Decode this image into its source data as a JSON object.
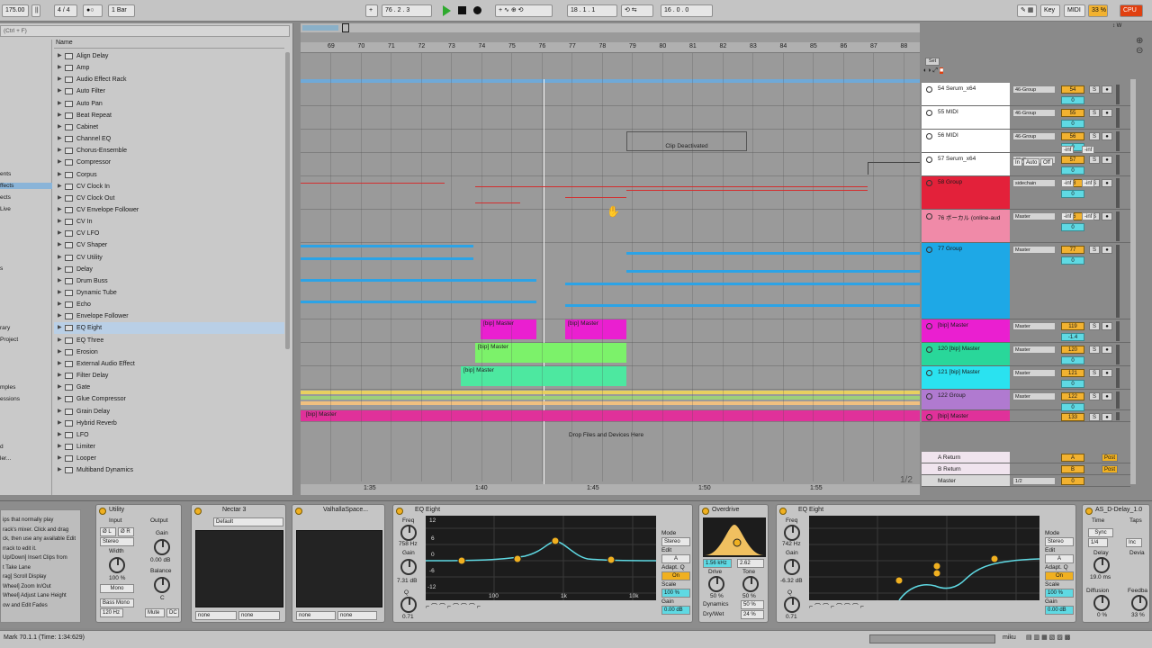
{
  "topbar": {
    "tempo": "175.00",
    "time_sig": "4 / 4",
    "quantize": "1 Bar",
    "position": "76 .  2 .  3",
    "loop_start": "18 .  1 .  1",
    "loop_len": "16 .  0 .  0",
    "key": "Key",
    "midi": "MIDI",
    "cpu_pct": "33 %",
    "cpu": "CPU"
  },
  "browser": {
    "search_placeholder": "(Ctrl + F)",
    "column_name": "Name",
    "places": [
      "ents",
      "ffects",
      "ects",
      "Live",
      "",
      "s",
      "rary",
      "Project",
      "",
      "mples",
      "essions",
      "",
      "d",
      "ler..."
    ],
    "items": [
      "Align Delay",
      "Amp",
      "Audio Effect Rack",
      "Auto Filter",
      "Auto Pan",
      "Beat Repeat",
      "Cabinet",
      "Channel EQ",
      "Chorus-Ensemble",
      "Compressor",
      "Corpus",
      "CV Clock In",
      "CV Clock Out",
      "CV Envelope Follower",
      "CV In",
      "CV LFO",
      "CV Shaper",
      "CV Utility",
      "Delay",
      "Drum Buss",
      "Dynamic Tube",
      "Echo",
      "Envelope Follower",
      "EQ Eight",
      "EQ Three",
      "Erosion",
      "External Audio Effect",
      "Filter Delay",
      "Gate",
      "Glue Compressor",
      "Grain Delay",
      "Hybrid Reverb",
      "LFO",
      "Limiter",
      "Looper",
      "Multiband Dynamics"
    ]
  },
  "ruler": {
    "bars": [
      "69",
      "70",
      "71",
      "72",
      "73",
      "74",
      "75",
      "76",
      "77",
      "78",
      "79",
      "80",
      "81",
      "82",
      "83",
      "84",
      "85",
      "86",
      "87",
      "88"
    ],
    "times": [
      "1:35",
      "1:40",
      "1:45",
      "1:50",
      "1:55"
    ]
  },
  "arrangement": {
    "clip_deactivated": "Clip Deactivated",
    "clip_bip_master": "[bip] Master",
    "drop_text": "Drop Files and Devices Here",
    "page_ratio": "1/2",
    "set_label": "Set"
  },
  "tracks": [
    {
      "name": "54 Serum_x64",
      "io": "46-Group",
      "num": "54",
      "vol": "0",
      "color": "#ffffff"
    },
    {
      "name": "55 MIDI",
      "io": "46-Group",
      "num": "55",
      "vol": "0",
      "color": "#ffffff"
    },
    {
      "name": "56 MIDI",
      "io": "46-Group",
      "num": "56",
      "vol": "0",
      "color": "#ffffff"
    },
    {
      "name": "57 Serum_x64",
      "io": "46-Group",
      "num": "57",
      "vol": "0",
      "color": "#ffffff"
    },
    {
      "name": "58 Group",
      "io": "sidechain",
      "num": "58",
      "vol": "0",
      "color": "#e3213a"
    },
    {
      "name": "76 ボーカル (online-aud",
      "io": "Master",
      "num": "76",
      "vol": "0",
      "color": "#f08aa8"
    },
    {
      "name": "77 Group",
      "io": "Master",
      "num": "77",
      "vol": "0",
      "color": "#1ea8e6"
    },
    {
      "name": "[bip] Master",
      "io": "Master",
      "num": "119",
      "vol": "-1.4",
      "color": "#ea1fd0"
    },
    {
      "name": "120 [bip] Master",
      "io": "Master",
      "num": "120",
      "vol": "0",
      "color": "#29d79a"
    },
    {
      "name": "121 [bip] Master",
      "io": "Master",
      "num": "121",
      "vol": "0",
      "color": "#2ae2f0"
    },
    {
      "name": "122 Group",
      "io": "Master",
      "num": "122",
      "vol": "0",
      "color": "#b07ad0"
    },
    {
      "name": "[bip] Master",
      "io": "",
      "num": "133",
      "vol": "0",
      "color": "#e0319a"
    }
  ],
  "returns": [
    {
      "name": "A Return",
      "num": "A",
      "post": "Post"
    },
    {
      "name": "B Return",
      "num": "B",
      "post": "Post"
    },
    {
      "name": "Master",
      "num": "0",
      "io": "1/2"
    }
  ],
  "meter_values": {
    "inf_a": "-inf",
    "inf_b": "-inf",
    "in": "In",
    "auto": "Auto",
    "off": "Off"
  },
  "info_text": [
    "ips that normally play",
    "rack's mixer. Click and drag",
    "ck, then use any available Edit",
    "rrack to edit it.",
    "",
    "Up/Down] Insert Clips from",
    "t Take Lane",
    "rag] Scroll Display",
    "Wheel] Zoom In/Out",
    "Wheel] Adjust Lane Height",
    "ow and Edit Fades"
  ],
  "devices": {
    "utility": {
      "title": "Utility",
      "input": "Input",
      "output": "Output",
      "stereo": "Stereo",
      "width": "Width",
      "width_val": "100 %",
      "mono": "Mono",
      "bass_mono": "Bass Mono",
      "bass_hz": "120 Hz",
      "gain": "Gain",
      "gain_val": "0.00 dB",
      "balance": "Balance",
      "balance_val": "C",
      "mute": "Mute",
      "dc": "DC",
      "l": "Ø L",
      "r": "Ø R"
    },
    "nectar": {
      "title": "Nectar 3",
      "preset": "Default",
      "none1": "none",
      "none2": "none"
    },
    "valhalla": {
      "title": "ValhallaSpace...",
      "none1": "none",
      "none2": "none"
    },
    "eq1": {
      "title": "EQ Eight",
      "freq": "Freq",
      "freq_val": "758 Hz",
      "gain": "Gain",
      "gain_val": "7.31 dB",
      "q": "Q",
      "q_val": "0.71",
      "mode": "Mode",
      "mode_val": "Stereo",
      "edit": "Edit",
      "edit_val": "A",
      "adapt": "Adapt. Q",
      "on": "On",
      "scale": "Scale",
      "scale_val": "100 %",
      "gain2": "Gain",
      "gain2_val": "0.00 dB",
      "db12": "12",
      "db6": "6",
      "db0": "0",
      "dbm6": "-6",
      "dbm12": "-12",
      "f100": "100",
      "f1k": "1k",
      "f10k": "10k"
    },
    "overdrive": {
      "title": "Overdrive",
      "freq": "1.56 kHz",
      "bw": "2.62",
      "drive": "Drive",
      "drive_val": "50 %",
      "tone": "Tone",
      "tone_val": "50 %",
      "dynamics": "Dynamics",
      "dyn_val": "50 %",
      "drywet": "Dry/Wet",
      "dw_val": "24 %"
    },
    "eq2": {
      "title": "EQ Eight",
      "freq": "Freq",
      "freq_val": "742 Hz",
      "gain": "Gain",
      "gain_val": "-6.32 dB",
      "q": "Q",
      "q_val": "0.71",
      "mode": "Mode",
      "mode_val": "Stereo",
      "edit": "Edit",
      "edit_val": "A",
      "adapt": "Adapt. Q",
      "on": "On",
      "scale": "Scale",
      "scale_val": "100 %",
      "gain2": "Gain",
      "gain2_val": "0.00 dB"
    },
    "delay": {
      "title": "AS_D-Delay_1.0",
      "time": "Time",
      "taps": "Taps",
      "sync": "Sync",
      "div": "1/4",
      "inc": "Inc",
      "delay": "Delay",
      "delay_val": "19.0 ms",
      "diffusion": "Diffusion",
      "diff_val": "0 %",
      "feedback": "Feedba",
      "fb_val": "33 %",
      "devi": "Devia"
    }
  },
  "status": {
    "left": "Mark 70.1.1 (Time: 1:34:629)",
    "right": "miku"
  },
  "colors": {
    "accent": "#f0b020",
    "selection": "#b9cfe6"
  }
}
